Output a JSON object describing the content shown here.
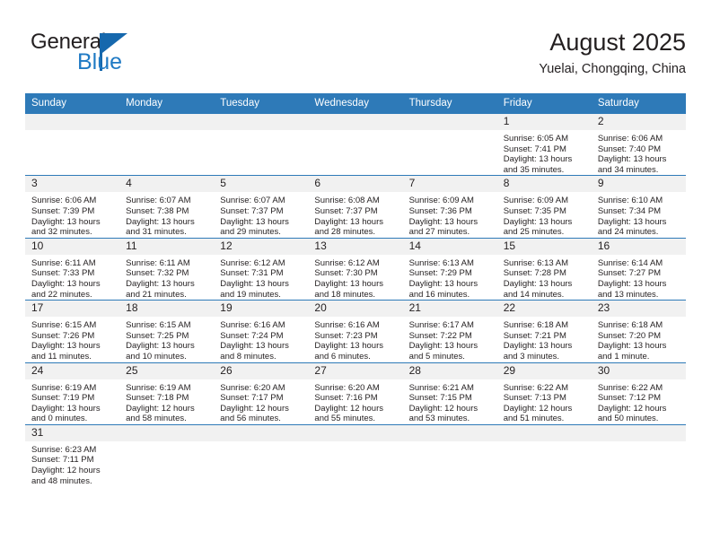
{
  "logo": {
    "word_one": "General",
    "word_two": "Blue",
    "triangle_color": "#1668ad",
    "blue_text_color": "#1f7ac4"
  },
  "header": {
    "title": "August 2025",
    "subtitle": "Yuelai, Chongqing, China",
    "header_bg_color": "#2e7ab8",
    "daynum_bg_color": "#f1f1f1"
  },
  "weekday_headers": [
    "Sunday",
    "Monday",
    "Tuesday",
    "Wednesday",
    "Thursday",
    "Friday",
    "Saturday"
  ],
  "weeks": [
    [
      {
        "day": "",
        "blank": true
      },
      {
        "day": "",
        "blank": true
      },
      {
        "day": "",
        "blank": true
      },
      {
        "day": "",
        "blank": true
      },
      {
        "day": "",
        "blank": true
      },
      {
        "day": "1",
        "sunrise": "Sunrise: 6:05 AM",
        "sunset": "Sunset: 7:41 PM",
        "daylight_1": "Daylight: 13 hours",
        "daylight_2": "and 35 minutes."
      },
      {
        "day": "2",
        "sunrise": "Sunrise: 6:06 AM",
        "sunset": "Sunset: 7:40 PM",
        "daylight_1": "Daylight: 13 hours",
        "daylight_2": "and 34 minutes."
      }
    ],
    [
      {
        "day": "3",
        "sunrise": "Sunrise: 6:06 AM",
        "sunset": "Sunset: 7:39 PM",
        "daylight_1": "Daylight: 13 hours",
        "daylight_2": "and 32 minutes."
      },
      {
        "day": "4",
        "sunrise": "Sunrise: 6:07 AM",
        "sunset": "Sunset: 7:38 PM",
        "daylight_1": "Daylight: 13 hours",
        "daylight_2": "and 31 minutes."
      },
      {
        "day": "5",
        "sunrise": "Sunrise: 6:07 AM",
        "sunset": "Sunset: 7:37 PM",
        "daylight_1": "Daylight: 13 hours",
        "daylight_2": "and 29 minutes."
      },
      {
        "day": "6",
        "sunrise": "Sunrise: 6:08 AM",
        "sunset": "Sunset: 7:37 PM",
        "daylight_1": "Daylight: 13 hours",
        "daylight_2": "and 28 minutes."
      },
      {
        "day": "7",
        "sunrise": "Sunrise: 6:09 AM",
        "sunset": "Sunset: 7:36 PM",
        "daylight_1": "Daylight: 13 hours",
        "daylight_2": "and 27 minutes."
      },
      {
        "day": "8",
        "sunrise": "Sunrise: 6:09 AM",
        "sunset": "Sunset: 7:35 PM",
        "daylight_1": "Daylight: 13 hours",
        "daylight_2": "and 25 minutes."
      },
      {
        "day": "9",
        "sunrise": "Sunrise: 6:10 AM",
        "sunset": "Sunset: 7:34 PM",
        "daylight_1": "Daylight: 13 hours",
        "daylight_2": "and 24 minutes."
      }
    ],
    [
      {
        "day": "10",
        "sunrise": "Sunrise: 6:11 AM",
        "sunset": "Sunset: 7:33 PM",
        "daylight_1": "Daylight: 13 hours",
        "daylight_2": "and 22 minutes."
      },
      {
        "day": "11",
        "sunrise": "Sunrise: 6:11 AM",
        "sunset": "Sunset: 7:32 PM",
        "daylight_1": "Daylight: 13 hours",
        "daylight_2": "and 21 minutes."
      },
      {
        "day": "12",
        "sunrise": "Sunrise: 6:12 AM",
        "sunset": "Sunset: 7:31 PM",
        "daylight_1": "Daylight: 13 hours",
        "daylight_2": "and 19 minutes."
      },
      {
        "day": "13",
        "sunrise": "Sunrise: 6:12 AM",
        "sunset": "Sunset: 7:30 PM",
        "daylight_1": "Daylight: 13 hours",
        "daylight_2": "and 18 minutes."
      },
      {
        "day": "14",
        "sunrise": "Sunrise: 6:13 AM",
        "sunset": "Sunset: 7:29 PM",
        "daylight_1": "Daylight: 13 hours",
        "daylight_2": "and 16 minutes."
      },
      {
        "day": "15",
        "sunrise": "Sunrise: 6:13 AM",
        "sunset": "Sunset: 7:28 PM",
        "daylight_1": "Daylight: 13 hours",
        "daylight_2": "and 14 minutes."
      },
      {
        "day": "16",
        "sunrise": "Sunrise: 6:14 AM",
        "sunset": "Sunset: 7:27 PM",
        "daylight_1": "Daylight: 13 hours",
        "daylight_2": "and 13 minutes."
      }
    ],
    [
      {
        "day": "17",
        "sunrise": "Sunrise: 6:15 AM",
        "sunset": "Sunset: 7:26 PM",
        "daylight_1": "Daylight: 13 hours",
        "daylight_2": "and 11 minutes."
      },
      {
        "day": "18",
        "sunrise": "Sunrise: 6:15 AM",
        "sunset": "Sunset: 7:25 PM",
        "daylight_1": "Daylight: 13 hours",
        "daylight_2": "and 10 minutes."
      },
      {
        "day": "19",
        "sunrise": "Sunrise: 6:16 AM",
        "sunset": "Sunset: 7:24 PM",
        "daylight_1": "Daylight: 13 hours",
        "daylight_2": "and 8 minutes."
      },
      {
        "day": "20",
        "sunrise": "Sunrise: 6:16 AM",
        "sunset": "Sunset: 7:23 PM",
        "daylight_1": "Daylight: 13 hours",
        "daylight_2": "and 6 minutes."
      },
      {
        "day": "21",
        "sunrise": "Sunrise: 6:17 AM",
        "sunset": "Sunset: 7:22 PM",
        "daylight_1": "Daylight: 13 hours",
        "daylight_2": "and 5 minutes."
      },
      {
        "day": "22",
        "sunrise": "Sunrise: 6:18 AM",
        "sunset": "Sunset: 7:21 PM",
        "daylight_1": "Daylight: 13 hours",
        "daylight_2": "and 3 minutes."
      },
      {
        "day": "23",
        "sunrise": "Sunrise: 6:18 AM",
        "sunset": "Sunset: 7:20 PM",
        "daylight_1": "Daylight: 13 hours",
        "daylight_2": "and 1 minute."
      }
    ],
    [
      {
        "day": "24",
        "sunrise": "Sunrise: 6:19 AM",
        "sunset": "Sunset: 7:19 PM",
        "daylight_1": "Daylight: 13 hours",
        "daylight_2": "and 0 minutes."
      },
      {
        "day": "25",
        "sunrise": "Sunrise: 6:19 AM",
        "sunset": "Sunset: 7:18 PM",
        "daylight_1": "Daylight: 12 hours",
        "daylight_2": "and 58 minutes."
      },
      {
        "day": "26",
        "sunrise": "Sunrise: 6:20 AM",
        "sunset": "Sunset: 7:17 PM",
        "daylight_1": "Daylight: 12 hours",
        "daylight_2": "and 56 minutes."
      },
      {
        "day": "27",
        "sunrise": "Sunrise: 6:20 AM",
        "sunset": "Sunset: 7:16 PM",
        "daylight_1": "Daylight: 12 hours",
        "daylight_2": "and 55 minutes."
      },
      {
        "day": "28",
        "sunrise": "Sunrise: 6:21 AM",
        "sunset": "Sunset: 7:15 PM",
        "daylight_1": "Daylight: 12 hours",
        "daylight_2": "and 53 minutes."
      },
      {
        "day": "29",
        "sunrise": "Sunrise: 6:22 AM",
        "sunset": "Sunset: 7:13 PM",
        "daylight_1": "Daylight: 12 hours",
        "daylight_2": "and 51 minutes."
      },
      {
        "day": "30",
        "sunrise": "Sunrise: 6:22 AM",
        "sunset": "Sunset: 7:12 PM",
        "daylight_1": "Daylight: 12 hours",
        "daylight_2": "and 50 minutes."
      }
    ],
    [
      {
        "day": "31",
        "sunrise": "Sunrise: 6:23 AM",
        "sunset": "Sunset: 7:11 PM",
        "daylight_1": "Daylight: 12 hours",
        "daylight_2": "and 48 minutes."
      },
      {
        "day": "",
        "blank": true
      },
      {
        "day": "",
        "blank": true
      },
      {
        "day": "",
        "blank": true
      },
      {
        "day": "",
        "blank": true
      },
      {
        "day": "",
        "blank": true
      },
      {
        "day": "",
        "blank": true
      }
    ]
  ]
}
